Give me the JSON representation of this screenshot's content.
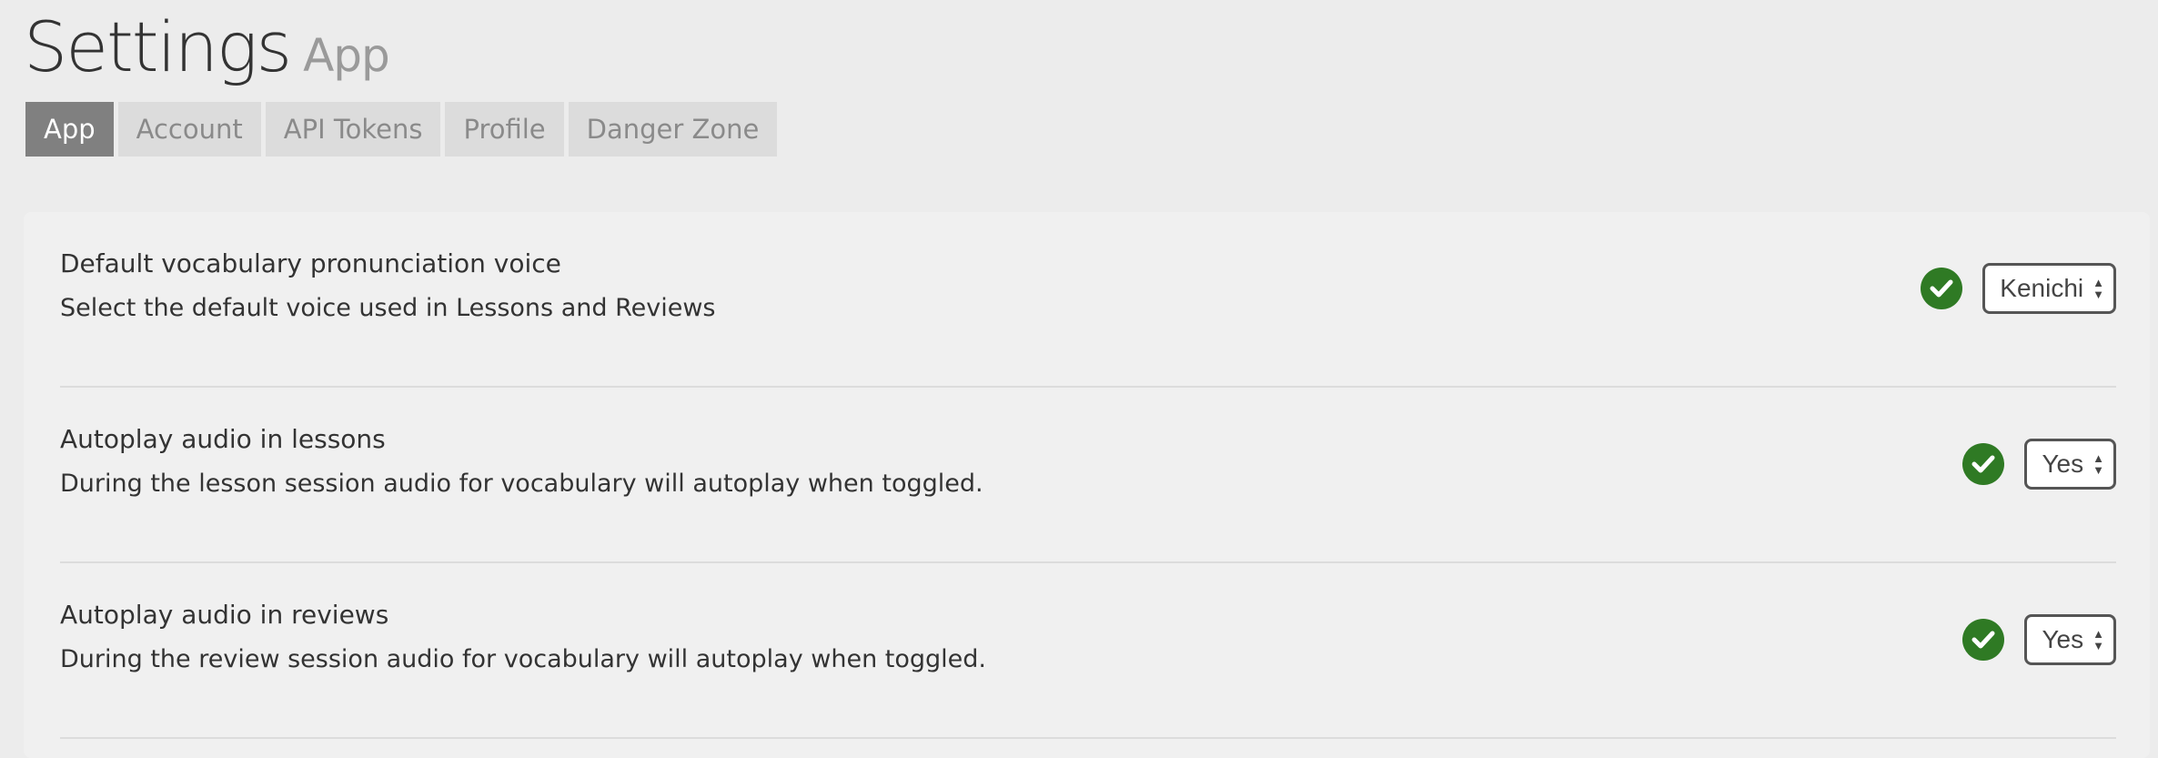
{
  "header": {
    "title": "Settings",
    "subtitle": "App"
  },
  "tabs": [
    {
      "label": "App",
      "active": true
    },
    {
      "label": "Account",
      "active": false
    },
    {
      "label": "API Tokens",
      "active": false
    },
    {
      "label": "Profile",
      "active": false
    },
    {
      "label": "Danger Zone",
      "active": false
    }
  ],
  "settings": [
    {
      "title": "Default vocabulary pronunciation voice",
      "description": "Select the default voice used in Lessons and Reviews",
      "value": "Kenichi",
      "saved_icon": "check-circle-icon"
    },
    {
      "title": "Autoplay audio in lessons",
      "description": "During the lesson session audio for vocabulary will autoplay when toggled.",
      "value": "Yes",
      "saved_icon": "check-circle-icon"
    },
    {
      "title": "Autoplay audio in reviews",
      "description": "During the review session audio for vocabulary will autoplay when toggled.",
      "value": "Yes",
      "saved_icon": "check-circle-icon"
    }
  ],
  "colors": {
    "active_tab": "#808080",
    "inactive_tab": "#dcdcdc",
    "success": "#2f7a24",
    "background": "#ececec"
  }
}
